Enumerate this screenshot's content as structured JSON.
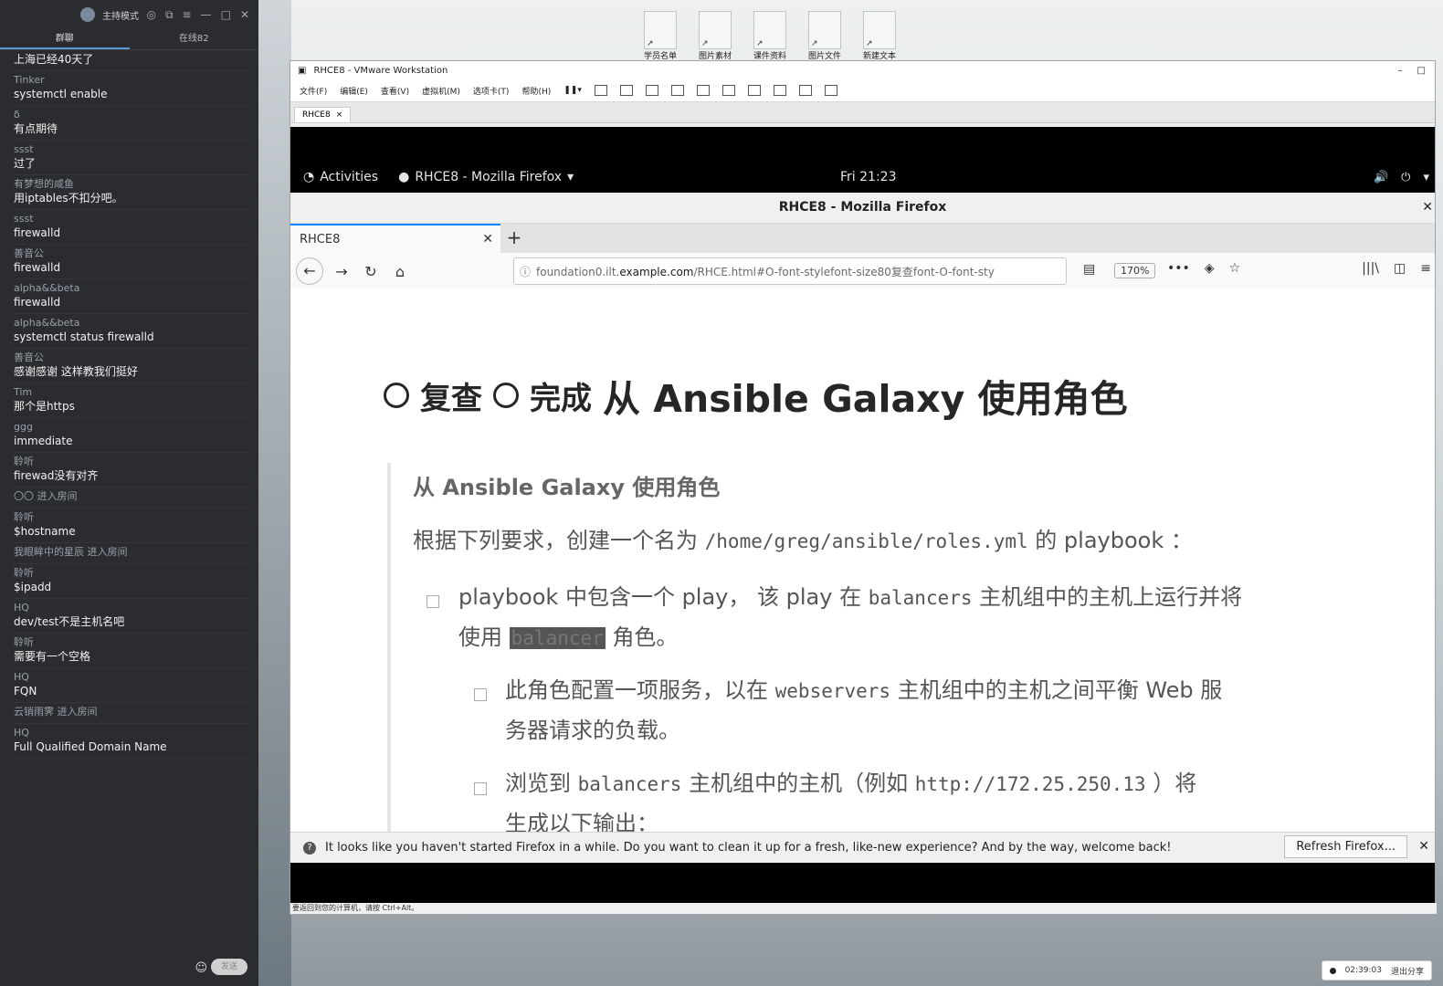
{
  "chat": {
    "header_title": "主持模式",
    "tabs": [
      "群聊",
      "在线82"
    ],
    "messages": [
      {
        "who": "",
        "text": "上海已经40天了"
      },
      {
        "who": "Tinker",
        "text": "systemctl enable"
      },
      {
        "who": "δ",
        "text": "有点期待"
      },
      {
        "who": "ssst",
        "text": "过了"
      },
      {
        "who": "有梦想的咸鱼",
        "text": "用iptables不扣分吧。"
      },
      {
        "who": "ssst",
        "text": "firewalld"
      },
      {
        "who": "善音公",
        "text": "firewalld"
      },
      {
        "who": "alpha&&beta",
        "text": "firewalld"
      },
      {
        "who": "alpha&&beta",
        "text": "systemctl status firewalld"
      },
      {
        "who": "善音公",
        "text": "感谢感谢 这样教我们挺好"
      },
      {
        "who": "Tim",
        "text": "那个是https"
      },
      {
        "who": "ggg",
        "text": "immediate"
      },
      {
        "who": "聆听",
        "text": "firewad没有对齐"
      },
      {
        "who": "",
        "text": "〇〇 进入房间",
        "system": true
      },
      {
        "who": "聆听",
        "text": "$hostname"
      },
      {
        "who": "",
        "text": "我眼眸中的星辰 进入房间",
        "system": true
      },
      {
        "who": "聆听",
        "text": "$ipadd"
      },
      {
        "who": "HQ",
        "text": "dev/test不是主机名吧"
      },
      {
        "who": "聆听",
        "text": "需要有一个空格"
      },
      {
        "who": "HQ",
        "text": "FQN"
      },
      {
        "who": "",
        "text": "云销雨霁 进入房间",
        "system": true
      },
      {
        "who": "HQ",
        "text": "Full Qualified Domain Name"
      }
    ],
    "send_label": "发送"
  },
  "desktop_icons": [
    "学员名单",
    "图片素材",
    "课件资料",
    "图片文件",
    "新建文本"
  ],
  "vmware": {
    "title": "RHCE8 - VMware Workstation",
    "menu": [
      "文件(F)",
      "编辑(E)",
      "查看(V)",
      "虚拟机(M)",
      "选项卡(T)",
      "帮助(H)"
    ],
    "tab": "RHCE8",
    "status_text": "要返回到您的计算机，请按 Ctrl+Alt。"
  },
  "gnome": {
    "activities": "Activities",
    "app": "RHCE8 - Mozilla Firefox",
    "clock": "Fri 21:23"
  },
  "firefox": {
    "title": "RHCE8 - Mozilla Firefox",
    "tab_label": "RHCE8",
    "url_prefix": "foundation0.ilt.",
    "url_host": "example.com",
    "url_rest": "/RHCE.html#O-font-stylefont-size80复查font-O-font-sty",
    "zoom": "170%",
    "notification": "It looks like you haven't started Firefox in a while. Do you want to clean it up for a fresh, like-new experience? And by the way, welcome back!",
    "refresh_button": "Refresh Firefox..."
  },
  "page": {
    "heading_review": "复查",
    "heading_done": "完成",
    "heading_title": "从 Ansible Galaxy 使用角色",
    "subheading": "从 Ansible Galaxy 使用角色",
    "intro_pre": "根据下列要求，创建一个名为",
    "intro_code": "/home/greg/ansible/roles.yml",
    "intro_post": "的 playbook ：",
    "item1_a": "playbook 中包含一个 play，  该 play 在",
    "item1_code": "balancers",
    "item1_b": "主机组中的主机上运行并将",
    "item1_c": "使用",
    "item1_code2": "balancer",
    "item1_d": "角色。",
    "item2_a": "此角色配置一项服务，以在",
    "item2_code": "webservers",
    "item2_b": "主机组中的主机之间平衡 Web 服",
    "item2_c": "务器请求的负载。",
    "item3_a": "浏览到",
    "item3_code": "balancers",
    "item3_b": "主机组中的主机（例如",
    "item3_code2": "http://172.25.250.13",
    "item3_c": "）将",
    "item3_d": "生成以下输出："
  },
  "share": {
    "timer": "02:39:03",
    "exit_label": "退出分享"
  }
}
